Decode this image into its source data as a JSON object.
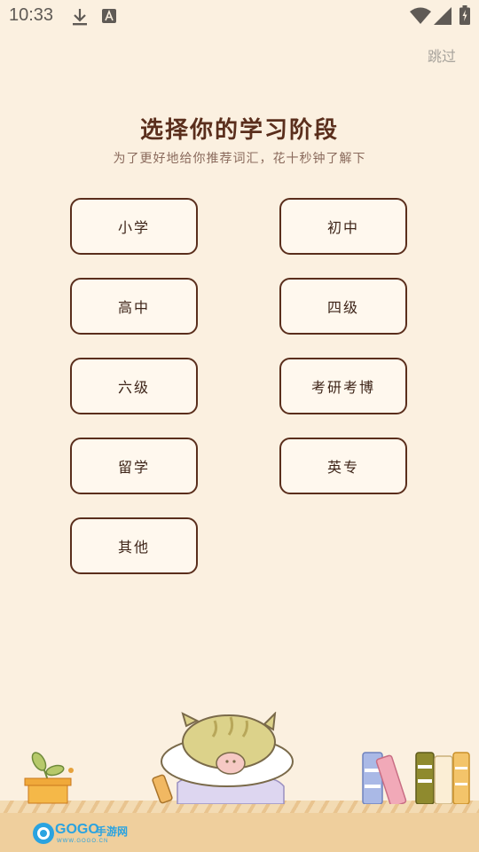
{
  "status_bar": {
    "time": "10:33"
  },
  "header": {
    "skip_label": "跳过"
  },
  "main": {
    "title": "选择你的学习阶段",
    "subtitle": "为了更好地给你推荐词汇，花十秒钟了解下",
    "options": [
      {
        "label": "小学"
      },
      {
        "label": "初中"
      },
      {
        "label": "高中"
      },
      {
        "label": "四级"
      },
      {
        "label": "六级"
      },
      {
        "label": "考研考博"
      },
      {
        "label": "留学"
      },
      {
        "label": "英专"
      },
      {
        "label": "其他"
      }
    ]
  },
  "watermark": {
    "brand_a": "GOGO",
    "brand_b": "手游网",
    "url": "WWW.GOGO.CN"
  }
}
